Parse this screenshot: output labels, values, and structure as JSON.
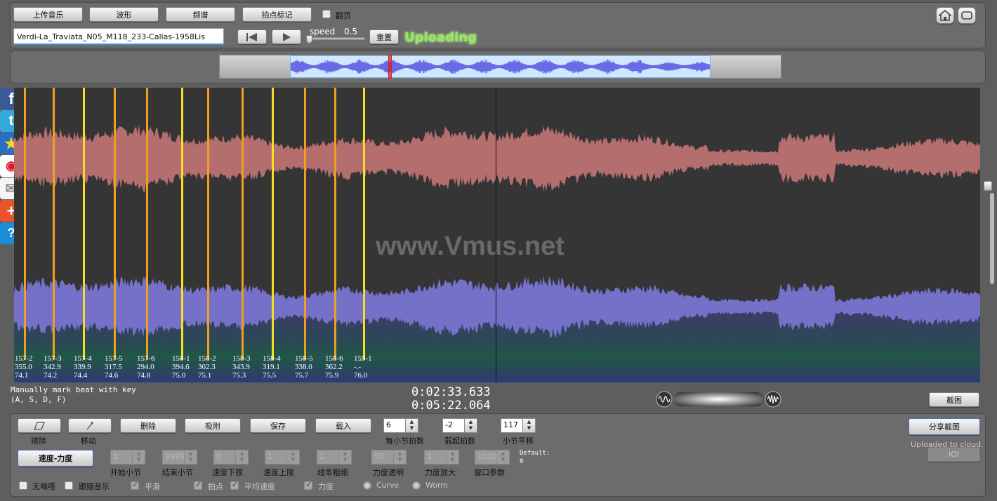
{
  "toolbar": {
    "upload": "上传音乐",
    "waveform": "波形",
    "spectrum": "频谱",
    "beat_mark": "拍点标记",
    "page_turn": "翻页"
  },
  "file": {
    "name": "Verdi-La_Traviata_N05_M118_233-Callas-1958Lis"
  },
  "transport": {
    "speed_label": "speed",
    "speed_value": "0.5",
    "reset": "重置",
    "status": "Uploading"
  },
  "watermark": "www.Vmus.net",
  "beats": [
    {
      "label": "157-2",
      "tempo": "355.0",
      "dyn": "74.1",
      "color": "#f0a020"
    },
    {
      "label": "157-3",
      "tempo": "342.9",
      "dyn": "74.2",
      "color": "#f0a020"
    },
    {
      "label": "157-4",
      "tempo": "339.9",
      "dyn": "74.4",
      "color": "#f5e020"
    },
    {
      "label": "157-5",
      "tempo": "317.5",
      "dyn": "74.6",
      "color": "#f0a020"
    },
    {
      "label": "157-6",
      "tempo": "294.0",
      "dyn": "74.8",
      "color": "#f0a020"
    },
    {
      "label": "158-1",
      "tempo": "394.6",
      "dyn": "75.0",
      "color": "#f5e020"
    },
    {
      "label": "158-2",
      "tempo": "302.3",
      "dyn": "75.1",
      "color": "#f0a020"
    },
    {
      "label": "158-3",
      "tempo": "343.9",
      "dyn": "75.3",
      "color": "#f0a020"
    },
    {
      "label": "158-4",
      "tempo": "319.1",
      "dyn": "75.5",
      "color": "#f5e020"
    },
    {
      "label": "158-5",
      "tempo": "338.0",
      "dyn": "75.7",
      "color": "#f0a020"
    },
    {
      "label": "158-6",
      "tempo": "362.2",
      "dyn": "75.9",
      "color": "#f0a020"
    },
    {
      "label": "159-1",
      "tempo": "-.-",
      "dyn": "76.0",
      "color": "#f5e020"
    }
  ],
  "hint": {
    "line1": "Manually mark beat with key",
    "line2": "(A, S, D, F)"
  },
  "time": {
    "current": "0:02:33.633",
    "total": "0:05:22.064"
  },
  "screenshot_btn": "截图",
  "controls": {
    "erase": "擦除",
    "move": "移动",
    "delete": "删除",
    "snap": "吸附",
    "save": "保存",
    "load": "载入",
    "beats_per_bar_value": "6",
    "beats_per_bar_label": "每小节拍数",
    "pickup_value": "-2",
    "pickup_label": "弱起拍数",
    "bar_offset_value": "117",
    "bar_offset_label": "小节平移",
    "share": "分享截图",
    "uploaded": "Uploaded to cloud.",
    "ioi": "IOI",
    "tempo_dynamics": "速度-力度",
    "start_bar_label": "开始小节",
    "end_bar_label": "结束小节",
    "tempo_min_label": "速度下限",
    "tempo_max_label": "速度上限",
    "line_width_label": "线条粗细",
    "dyn_opacity_label": "力度透明",
    "dyn_zoom_label": "力度放大",
    "window_param_label": "窗口参数",
    "start_bar_value": "1",
    "end_bar_value": "9999",
    "tempo_min_value": "0",
    "tempo_max_value": "1",
    "line_width_value": "1",
    "dyn_opacity_value": "50",
    "dyn_zoom_value": "1",
    "window_param_value": "1000",
    "default_label": "Default:",
    "default_value": "0",
    "opt_metronome": "无嘀嗒",
    "opt_follow": "跟随音乐",
    "opt_smooth": "平滑",
    "opt_beat": "拍点",
    "opt_avg_tempo": "平均速度",
    "opt_dynamics": "力度",
    "opt_curve": "Curve",
    "opt_worm": "Worm"
  }
}
